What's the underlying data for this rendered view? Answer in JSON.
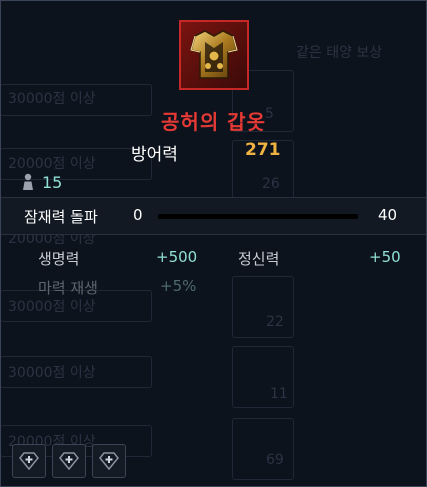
{
  "item": {
    "name": "공허의 갑옷",
    "stat_label": "방어력",
    "stat_value": "271",
    "level": "15"
  },
  "limit_break": {
    "label": "잠재력 돌파",
    "min": "0",
    "max": "40",
    "progress": 0
  },
  "options": [
    {
      "label": "생명력",
      "value": "+500"
    },
    {
      "label": "정신력",
      "value": "+50"
    },
    {
      "label": "마력 재생",
      "value": "+5%"
    }
  ],
  "background_text": {
    "header": "같은 태양 보상",
    "rows": [
      "30000점 이상",
      "20000점 이상",
      "20000점 이상",
      "30000점 이상",
      "30000점 이상",
      "20000점 이상"
    ],
    "numbers": [
      "5",
      "26",
      "22",
      "11",
      "69"
    ]
  },
  "gem_slots": 3,
  "colors": {
    "title": "#e53935",
    "stat_value": "#f0b341",
    "option_value": "#8fe0d6",
    "background": "#0d131c"
  }
}
